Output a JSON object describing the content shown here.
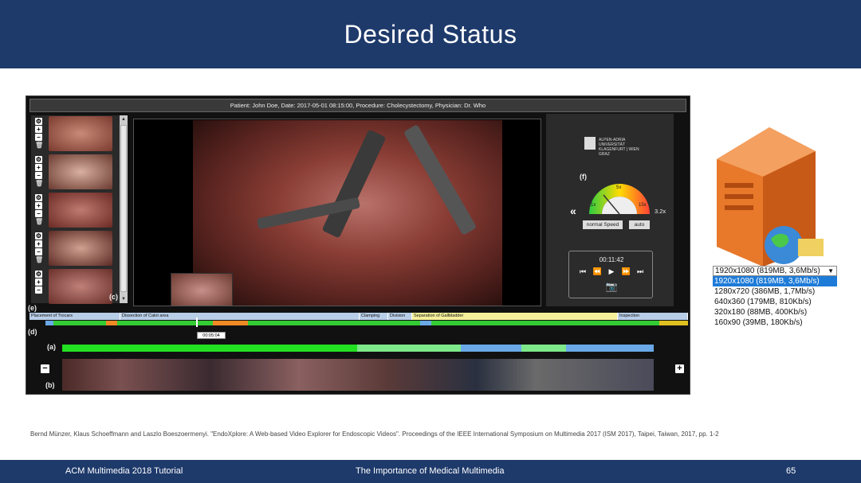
{
  "slide": {
    "title": "Desired Status",
    "citation": "Bernd Münzer, Klaus Schoeffmann and Laszlo Boeszoermenyi. \"EndoXplore: A Web-based Video Explorer for Endoscopic Videos\". Proceedings of the IEEE International Symposium on Multimedia 2017 (ISM 2017), Taipei, Taiwan, 2017, pp. 1-2",
    "footer_left": "ACM Multimedia 2018 Tutorial",
    "footer_center": "The Importance of Medical Multimedia",
    "footer_page": "65"
  },
  "app": {
    "patient_info": "Patient: John Doe, Date: 2017-05-01 08:15:00, Procedure: Cholecystectomy, Physician: Dr. Who",
    "labels": {
      "a": "(a)",
      "b": "(b)",
      "c": "(c)",
      "d": "(d)",
      "e": "(e)",
      "f": "(f)"
    },
    "logo_text": "ALPEN-ADRIA UNIVERSITÄT KLAGENFURT | WIEN GRAZ",
    "gauge": {
      "value_label": "3.2x",
      "tick_1x": "1x",
      "tick_5x": "5x",
      "tick_15x": "15x"
    },
    "speed_buttons": {
      "normal": "normal Speed",
      "auto": "auto"
    },
    "player_time": "00:11:42",
    "tooltip_time": "00:05:04",
    "phases": [
      {
        "label": "Placement of Trocars",
        "color": "#b8cde6"
      },
      {
        "label": "Dissection of Calot area",
        "color": "#b8cde6"
      },
      {
        "label": "Clamping",
        "color": "#b8cde6"
      },
      {
        "label": "Division",
        "color": "#b8cde6"
      },
      {
        "label": "Separation of Gallbladder",
        "color": "#f4f09a"
      },
      {
        "label": "Inspection",
        "color": "#b8cde6"
      }
    ]
  },
  "quality": {
    "selected": "1920x1080 (819MB, 3,6Mb/s)",
    "options": [
      "1920x1080 (819MB, 3,6Mb/s)",
      "1280x720 (386MB, 1,7Mb/s)",
      "640x360 (179MB, 810Kb/s)",
      "320x180 (88MB, 400Kb/s)",
      "160x90 (39MB, 180Kb/s)"
    ]
  },
  "colors": {
    "header": "#1e3a6b",
    "timeline_green": "#33cc33",
    "timeline_blue": "#6aa9e6",
    "highlight": "#1e7bd8"
  }
}
